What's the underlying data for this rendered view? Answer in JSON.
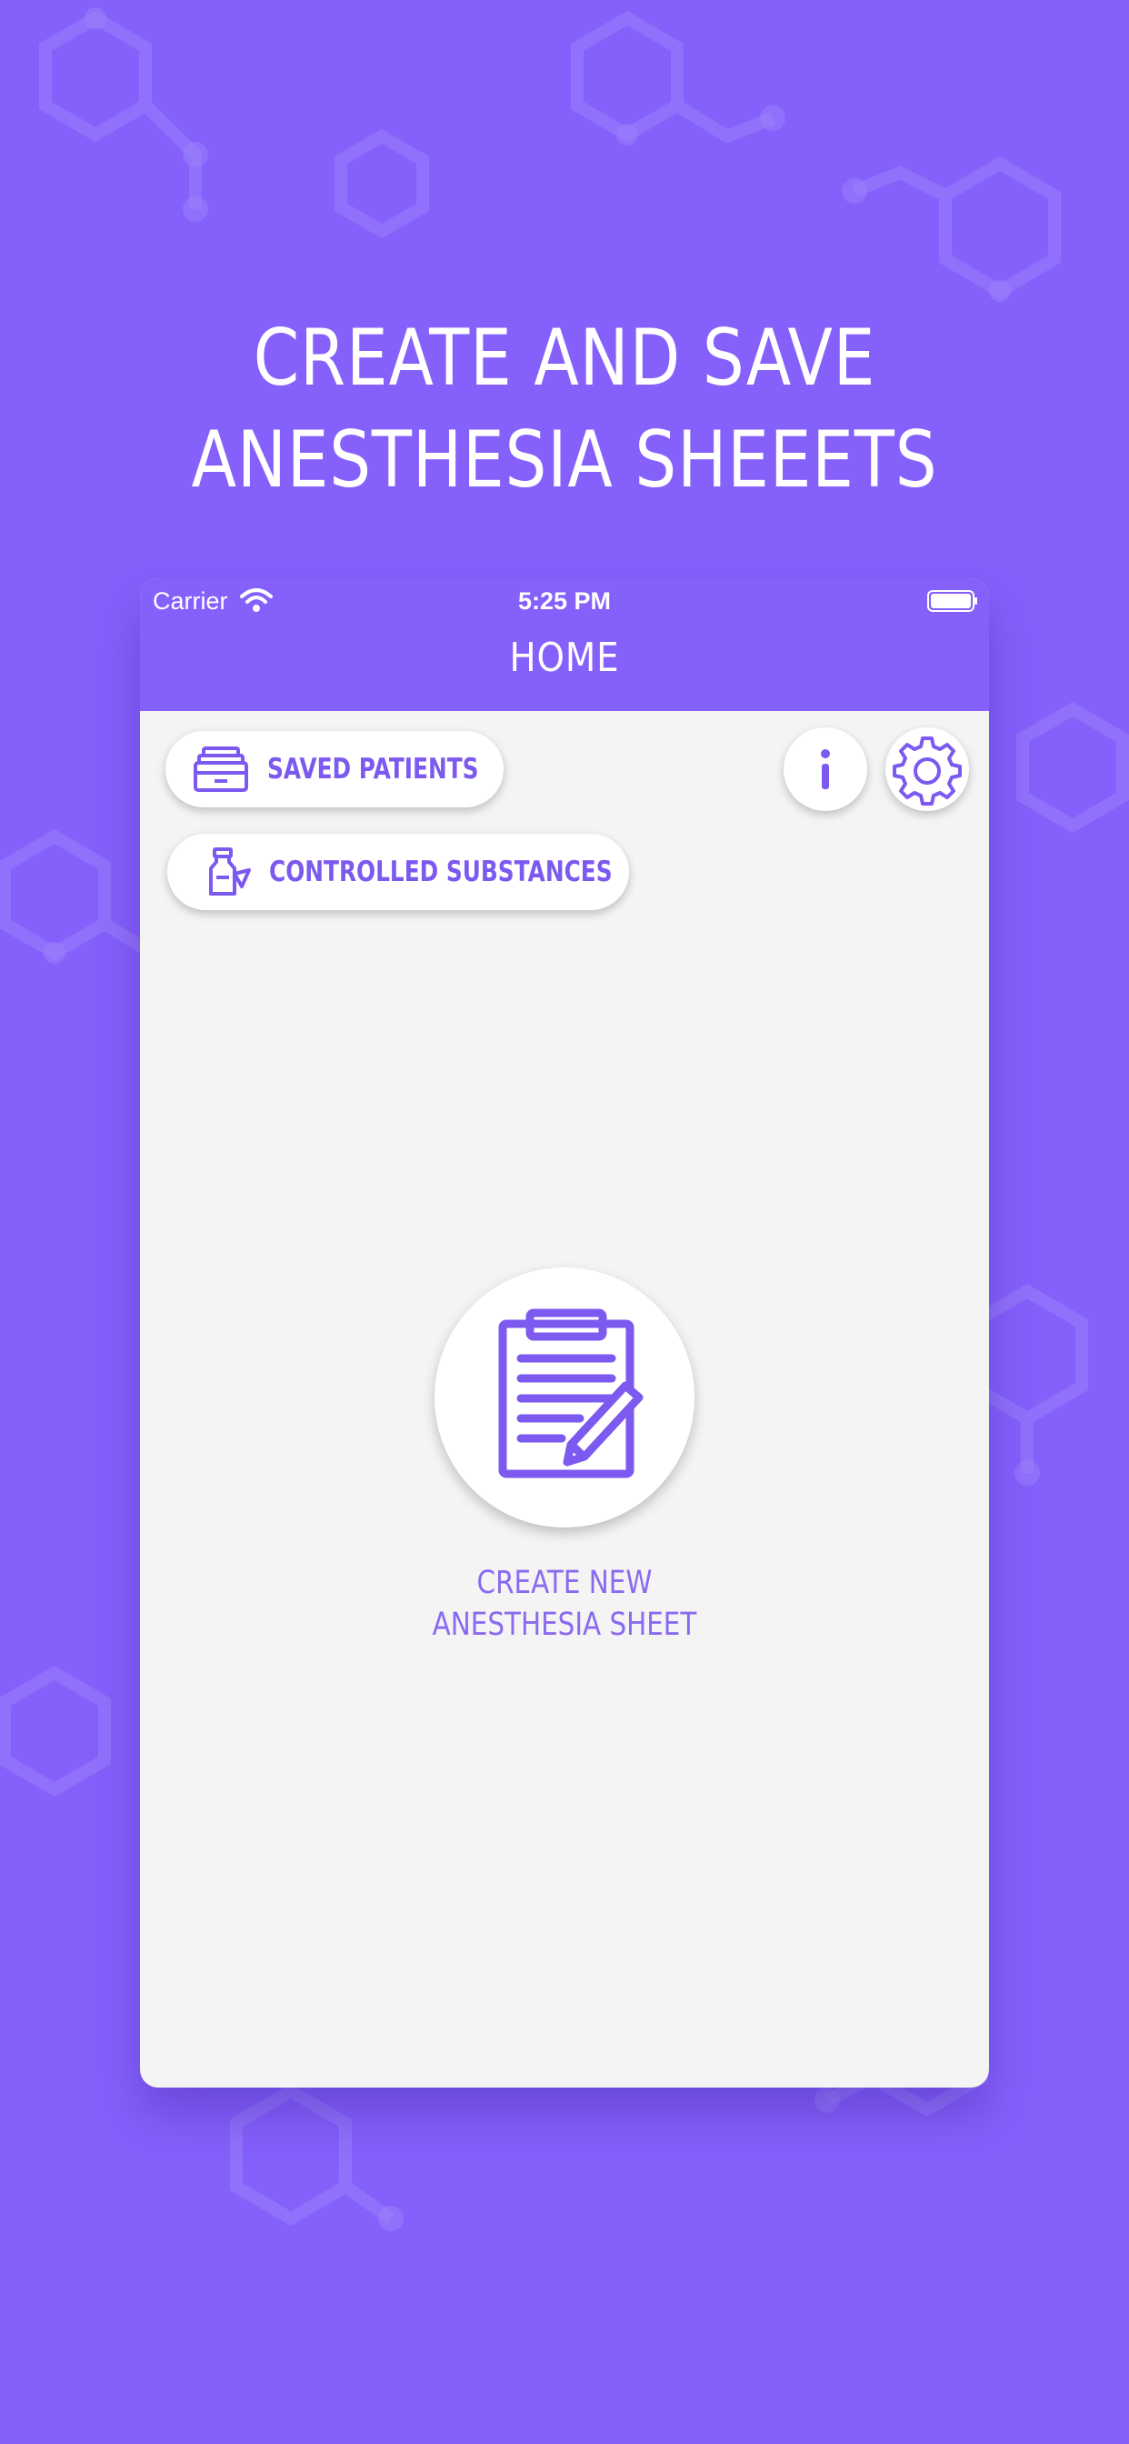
{
  "headline": {
    "line1": "CREATE AND SAVE",
    "line2": "ANESTHESIA SHEEETS"
  },
  "status_bar": {
    "carrier": "Carrier",
    "time": "5:25 PM"
  },
  "nav": {
    "title": "HOME"
  },
  "buttons": {
    "saved_patients": "SAVED PATIENTS",
    "controlled_substances": "CONTROLLED SUBSTANCES",
    "info_icon": "info-icon",
    "settings_icon": "gear-icon"
  },
  "create": {
    "line1": "CREATE NEW",
    "line2": "ANESTHESIA SHEET",
    "icon": "clipboard-pencil-icon"
  },
  "colors": {
    "background": "#8560fb",
    "accent": "#7c59ef",
    "panel": "#f4f4f4",
    "white": "#ffffff"
  }
}
